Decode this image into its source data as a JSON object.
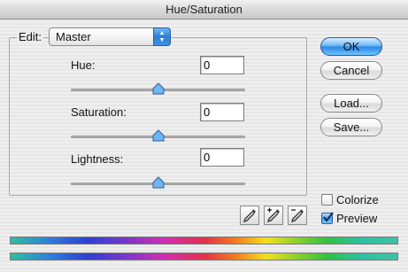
{
  "window": {
    "title": "Hue/Saturation"
  },
  "edit": {
    "label": "Edit:",
    "selected": "Master"
  },
  "hue": {
    "label": "Hue:",
    "value": "0",
    "level": 0.5
  },
  "saturation": {
    "label": "Saturation:",
    "value": "0",
    "level": 0.5
  },
  "lightness": {
    "label": "Lightness:",
    "value": "0",
    "level": 0.5
  },
  "buttons": {
    "ok": "OK",
    "cancel": "Cancel",
    "load": "Load...",
    "save": "Save..."
  },
  "options": {
    "colorize": {
      "label": "Colorize",
      "checked": false
    },
    "preview": {
      "label": "Preview",
      "checked": true
    }
  },
  "icons": [
    "eyedropper-icon",
    "eyedropper-plus-icon",
    "eyedropper-minus-icon",
    "chevron-updown-icon",
    "slider-thumb-icon",
    "checkmark-icon"
  ],
  "colors": {
    "accent": "#3d93e6",
    "thumb": "#6fb6f3"
  }
}
